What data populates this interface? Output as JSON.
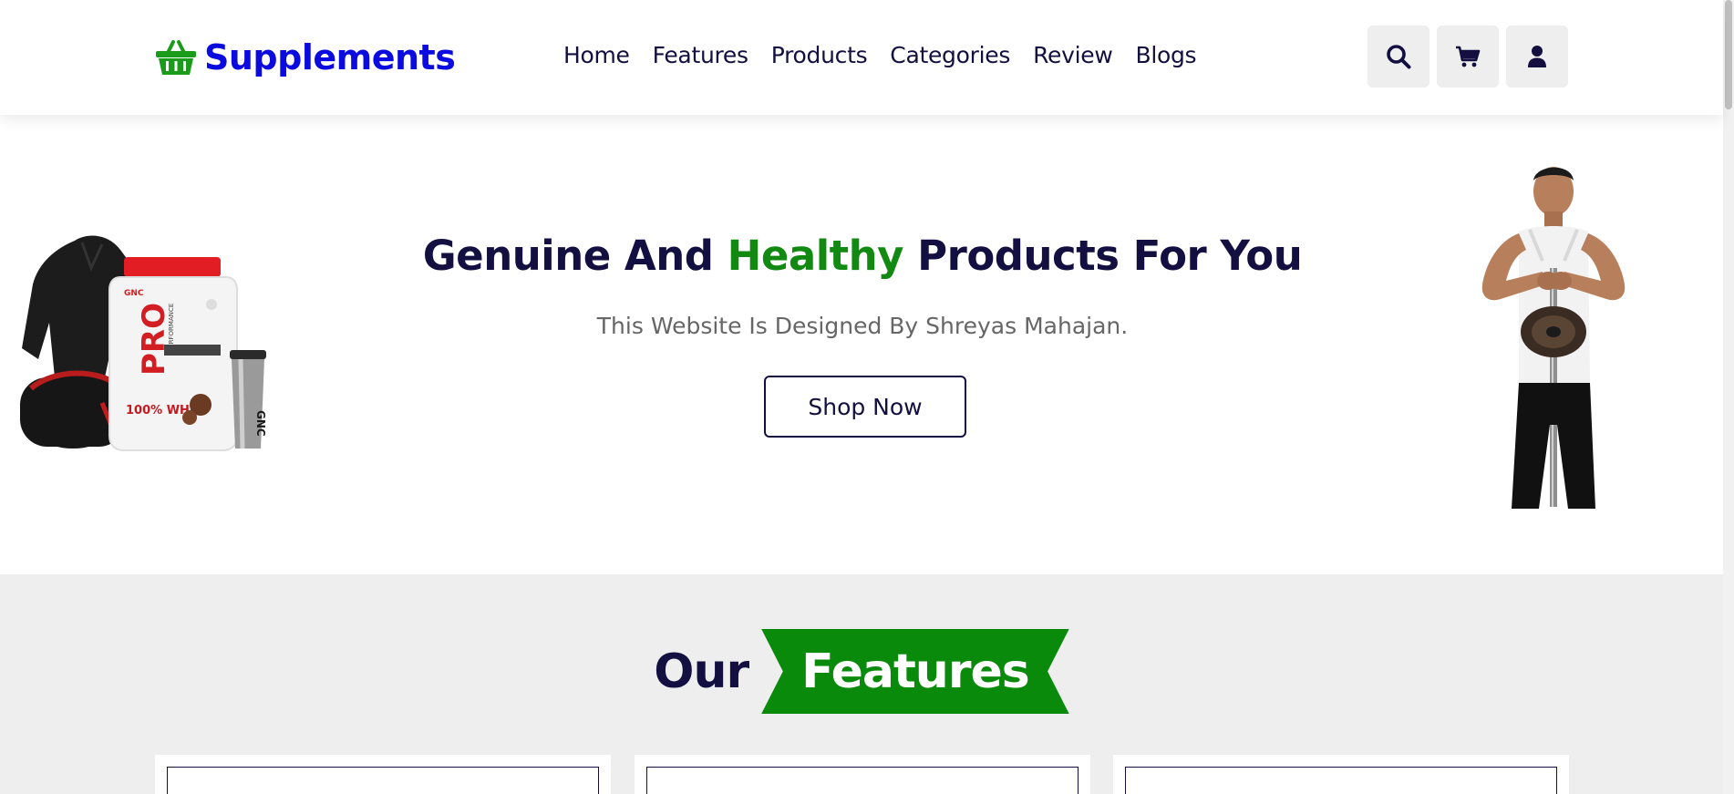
{
  "brand": {
    "name": "Supplements",
    "logo_icon": "basket-icon",
    "logo_color": "#0b0bdf",
    "icon_color": "#1a9c1a"
  },
  "nav": {
    "items": [
      "Home",
      "Features",
      "Products",
      "Categories",
      "Review",
      "Blogs"
    ]
  },
  "header_icons": [
    {
      "name": "search-icon",
      "label": "Search"
    },
    {
      "name": "cart-icon",
      "label": "Cart"
    },
    {
      "name": "user-icon",
      "label": "Account"
    }
  ],
  "hero": {
    "title_before": "Genuine And ",
    "title_accent": "Healthy",
    "title_after": " Products For You",
    "subtitle": "This Website Is Designed By Shreyas Mahajan.",
    "cta_label": "Shop Now",
    "accent_color": "#128a12",
    "text_color": "#130f40",
    "left_image_text": {
      "brand": "GNC",
      "line1": "PRO",
      "line2": "PERFORMANCE",
      "line3": "100% WHEY"
    }
  },
  "features_section": {
    "heading_plain": "Our",
    "heading_highlight": "Features",
    "highlight_bg": "#0a8a0a",
    "section_bg": "#eeeeee"
  }
}
